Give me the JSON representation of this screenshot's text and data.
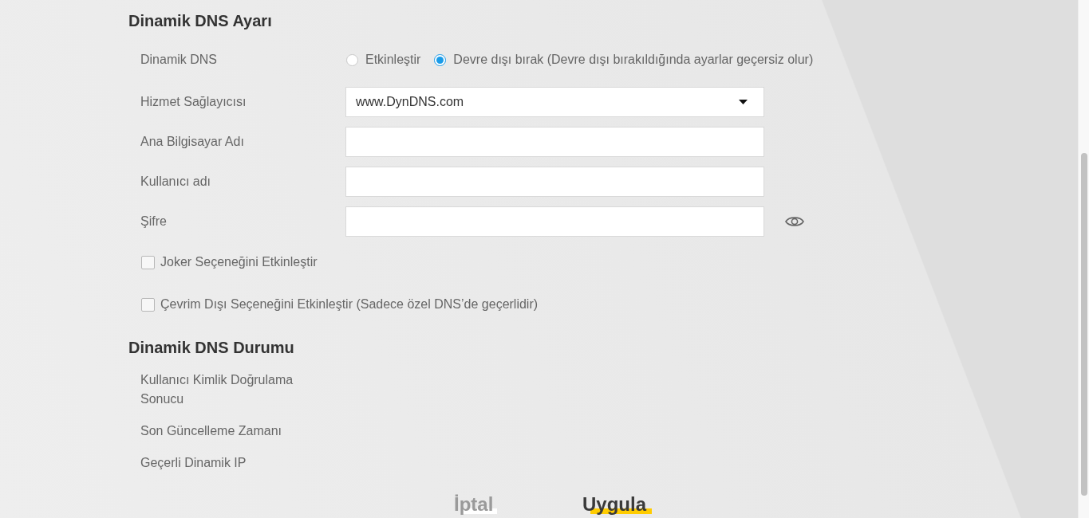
{
  "settings": {
    "title": "Dinamik DNS Ayarı",
    "rows": [
      {
        "kind": "radio",
        "label": "Dinamik DNS",
        "options": [
          {
            "label": "Etkinleştir",
            "selected": false
          },
          {
            "label": "Devre dışı bırak (Devre dışı bırakıldığında ayarlar geçersiz olur)",
            "selected": true
          }
        ]
      },
      {
        "kind": "select",
        "label": "Hizmet Sağlayıcısı",
        "value": "www.DynDNS.com"
      },
      {
        "kind": "text",
        "label": "Ana Bilgisayar Adı"
      },
      {
        "kind": "text",
        "label": "Kullanıcı adı"
      },
      {
        "kind": "password",
        "label": "Şifre"
      }
    ],
    "checkboxes": [
      {
        "label": "Joker Seçeneğini Etkinleştir",
        "checked": false
      },
      {
        "label": "Çevrim Dışı Seçeneğini Etkinleştir (Sadece özel DNS’de geçerlidir)",
        "checked": false
      }
    ]
  },
  "status": {
    "title": "Dinamik DNS Durumu",
    "rows": [
      "Kullanıcı Kimlik Doğrulama Sonucu",
      "Son Güncelleme Zamanı",
      "Geçerli Dinamik IP"
    ]
  },
  "buttons": [
    {
      "kind": "cancel",
      "label": "İptal"
    },
    {
      "kind": "apply",
      "label": "Uygula"
    }
  ]
}
